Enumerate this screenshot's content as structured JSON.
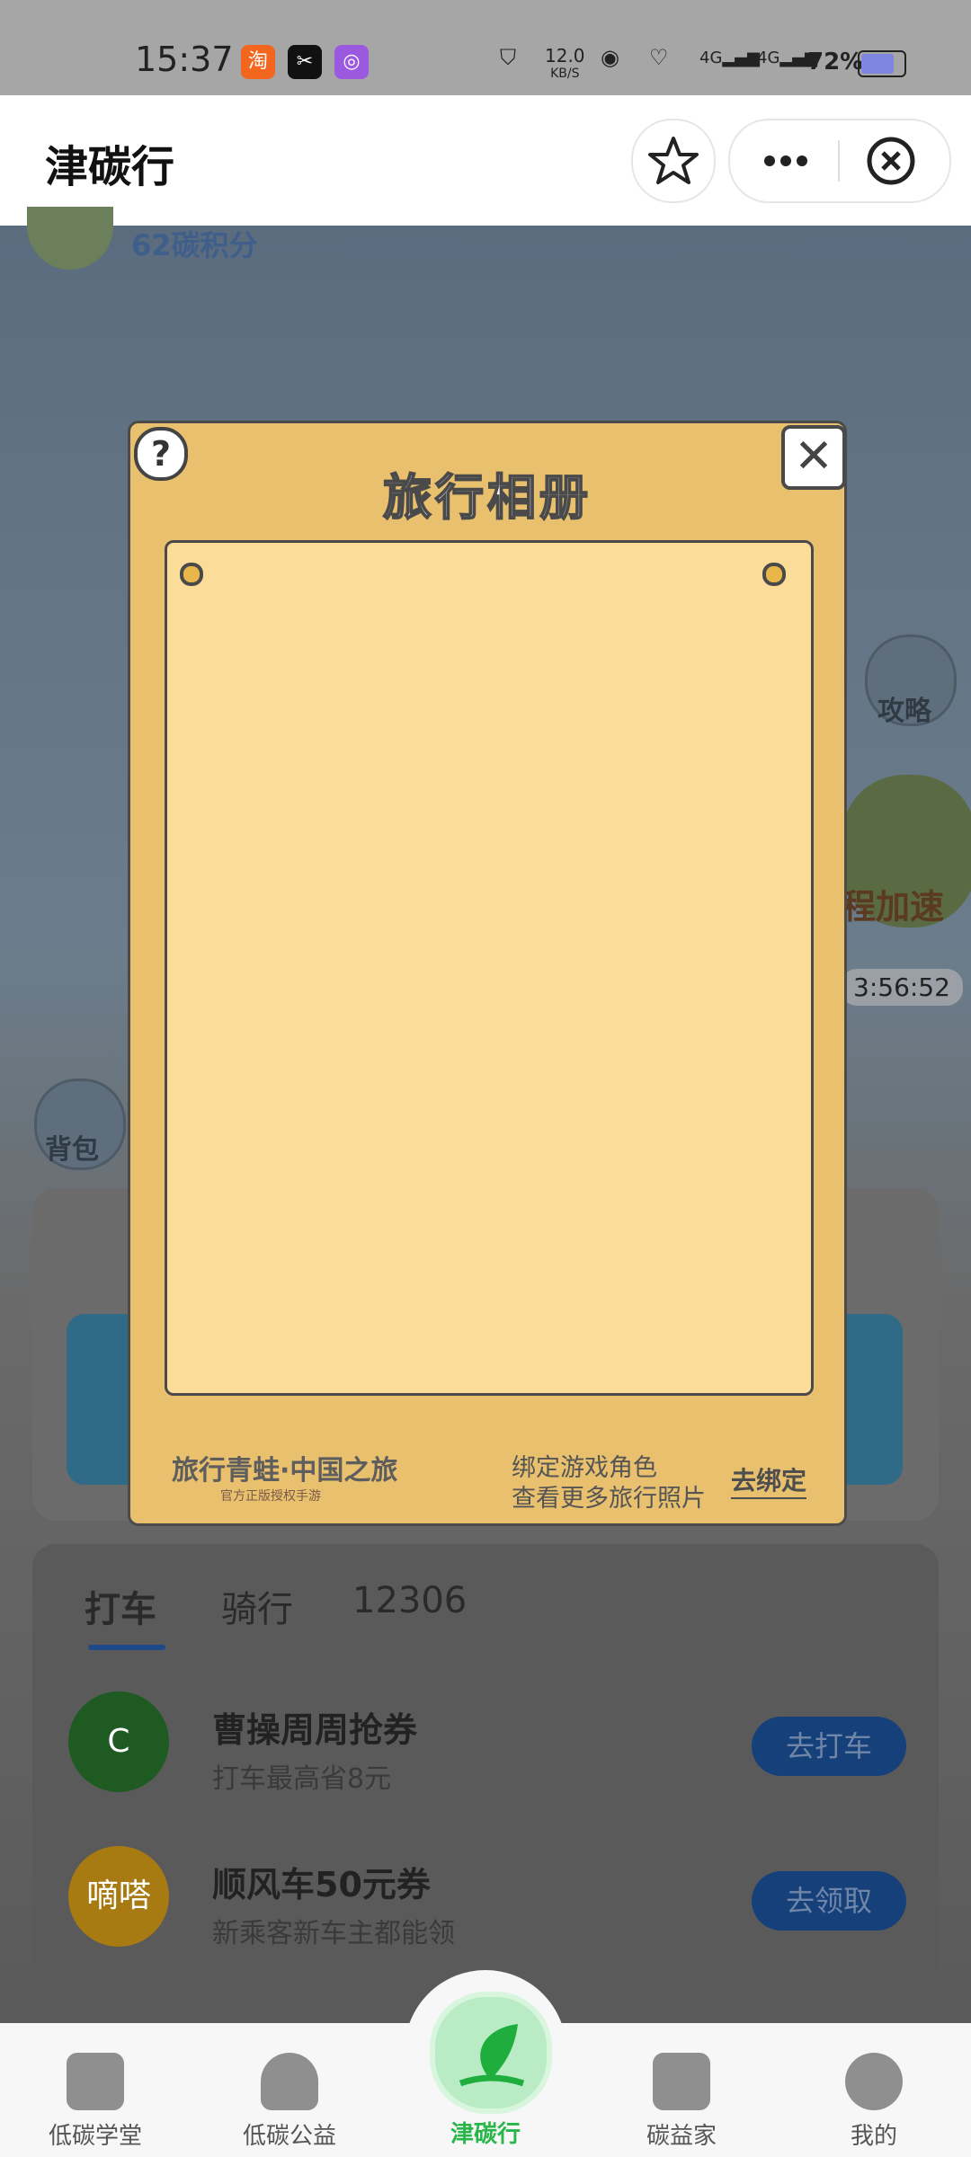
{
  "status_bar": {
    "time": "15:37",
    "net_speed": "12.0",
    "net_unit": "KB/S",
    "sig1": "4G",
    "sig2": "4G",
    "battery": "72%"
  },
  "apps": [
    "淘",
    "✂",
    "◎"
  ],
  "header": {
    "title": "津碳行"
  },
  "game": {
    "score": "62碳积分",
    "guide": "攻略",
    "speed": "程加速",
    "timer": "3:56:52",
    "backpack": "背包"
  },
  "tabs": [
    "打车",
    "骑行",
    "12306"
  ],
  "promos": [
    {
      "logo": "C",
      "title": "曹操周周抢券",
      "subtitle": "打车最高省8元",
      "button": "去打车",
      "color": "#1e5a22"
    },
    {
      "logo": "嘀嗒",
      "title": "顺风车50元券",
      "subtitle": "新乘客新车主都能领",
      "button": "去领取",
      "color": "#a87a12"
    }
  ],
  "modal": {
    "title": "旅行相册",
    "help": "?",
    "close": "✕",
    "brand": "旅行青蛙·中国之旅",
    "brand_sub": "官方正版授权手游",
    "bind_line1": "绑定游戏角色",
    "bind_line2": "查看更多旅行照片",
    "bind_button": "去绑定"
  },
  "nav": [
    {
      "label": "低碳学堂",
      "icon": "book-icon"
    },
    {
      "label": "低碳公益",
      "icon": "heart-hands-icon"
    },
    {
      "label": "津碳行",
      "icon": "leaf-icon"
    },
    {
      "label": "碳益家",
      "icon": "store-icon"
    },
    {
      "label": "我的",
      "icon": "user-icon"
    }
  ]
}
